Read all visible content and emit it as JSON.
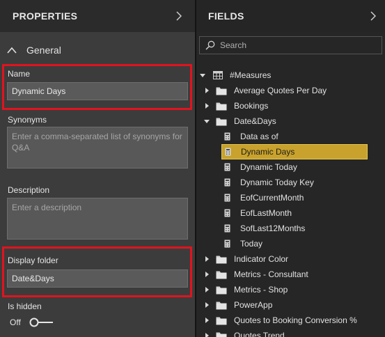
{
  "properties": {
    "title": "PROPERTIES",
    "section": "General",
    "name_label": "Name",
    "name_value": "Dynamic Days",
    "synonyms_label": "Synonyms",
    "synonyms_placeholder": "Enter a comma-separated list of synonyms for Q&A",
    "description_label": "Description",
    "description_placeholder": "Enter a description",
    "display_folder_label": "Display folder",
    "display_folder_value": "Date&Days",
    "is_hidden_label": "Is hidden",
    "is_hidden_state": "Off"
  },
  "fields": {
    "title": "FIELDS",
    "search_placeholder": "Search",
    "root": "#Measures",
    "folders_before": [
      "Average Quotes Per Day",
      "Bookings"
    ],
    "open_folder": "Date&Days",
    "measures": [
      "Data as of",
      "Dynamic Days",
      "Dynamic Today",
      "Dynamic Today Key",
      "EofCurrentMonth",
      "EofLastMonth",
      "SofLast12Months",
      "Today"
    ],
    "selected_measure": "Dynamic Days",
    "folders_after": [
      "Indicator Color",
      "Metrics - Consultant",
      "Metrics - Shop",
      "PowerApp",
      "Quotes to Booking Conversion %",
      "Quotes Trend"
    ]
  },
  "colors": {
    "highlight_border": "#e0141f",
    "selected_bg": "#c8a22c"
  }
}
